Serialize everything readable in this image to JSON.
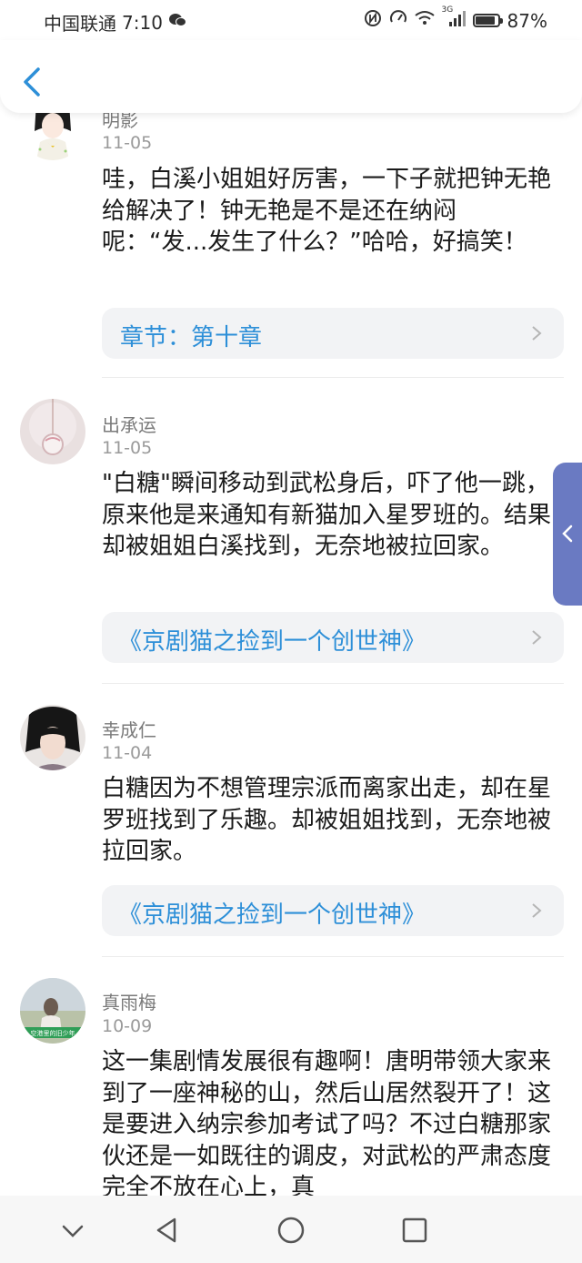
{
  "status_bar": {
    "carrier": "中国联通",
    "time": "7:10",
    "network": "3G",
    "battery": "87%",
    "battery_level": 0.87
  },
  "header": {
    "back_icon": "chevron-left-icon"
  },
  "comments": [
    {
      "username": "明影",
      "date": "11-05",
      "text": "哇，白溪小姐姐好厉害，一下子就把钟无艳给解决了！钟无艳是不是还在纳闷呢：“发...发生了什么？”哈哈，好搞笑！",
      "link": "章节：第十章"
    },
    {
      "username": "出承运",
      "date": "11-05",
      "text": "\"白糖\"瞬间移动到武松身后，吓了他一跳，原来他是来通知有新猫加入星罗班的。结果却被姐姐白溪找到，无奈地被拉回家。",
      "link": "《京剧猫之捡到一个创世神》"
    },
    {
      "username": "幸成仁",
      "date": "11-04",
      "text": "白糖因为不想管理宗派而离家出走，却在星罗班找到了乐趣。却被姐姐找到，无奈地被拉回家。",
      "link": "《京剧猫之捡到一个创世神》"
    },
    {
      "username": "真雨梅",
      "date": "10-09",
      "text": "这一集剧情发展很有趣啊！唐明带领大家来到了一座神秘的山，然后山居然裂开了！这是要进入纳宗参加考试了吗？不过白糖那家伙还是一如既往的调皮，对武松的严肃态度完全不放在心上，真"
    }
  ],
  "avatar4_caption": "空港里的旧少年",
  "colors": {
    "link": "#2d8fd8",
    "side_tab": "#6a7ac2",
    "back": "#2d8fd8"
  }
}
